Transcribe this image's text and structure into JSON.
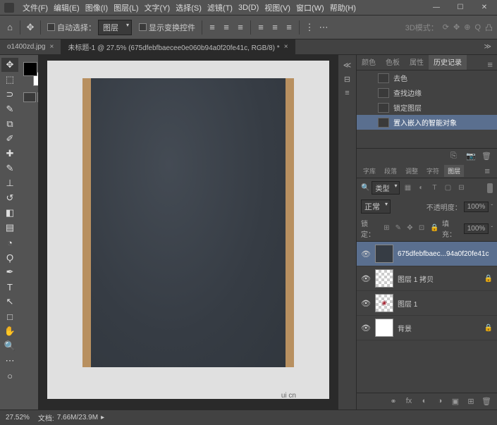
{
  "menu": {
    "items": [
      "文件(F)",
      "编辑(E)",
      "图像(I)",
      "图层(L)",
      "文字(Y)",
      "选择(S)",
      "滤镜(T)",
      "3D(D)",
      "视图(V)",
      "窗口(W)",
      "帮助(H)"
    ]
  },
  "options": {
    "auto_select_label": "自动选择：",
    "target": "图层",
    "transform_label": "显示变换控件",
    "mode3d_label": "3D模式："
  },
  "tabs": {
    "tab1": "o1400zd.jpg",
    "tab2": "未标题-1 @ 27.5% (675dfebfbaecee0e060b94a0f20fe41c, RGB/8) *"
  },
  "panels": {
    "tabs_top": [
      "颜色",
      "色板",
      "属性",
      "历史记录"
    ],
    "tabs_layers": [
      "字库",
      "段落",
      "调整",
      "字符",
      "图层"
    ]
  },
  "history": {
    "items": [
      {
        "label": "去色"
      },
      {
        "label": "查找边缘"
      },
      {
        "label": "锁定图层"
      },
      {
        "label": "置入嵌入的智能对象"
      }
    ]
  },
  "layers_filter": {
    "kind": "类型"
  },
  "blend": {
    "mode": "正常",
    "opacity_label": "不透明度：",
    "opacity": "100%",
    "lock_label": "锁定：",
    "fill_label": "填充：",
    "fill": "100%"
  },
  "layers": [
    {
      "name": "675dfebfbaec...94a0f20fe41c",
      "thumb": "dark",
      "locked": false
    },
    {
      "name": "图层 1 拷贝",
      "thumb": "checker",
      "locked": true
    },
    {
      "name": "图层 1",
      "thumb": "checker",
      "locked": false
    },
    {
      "name": "背景",
      "thumb": "white",
      "locked": true
    }
  ],
  "status": {
    "zoom": "27.52%",
    "doc_label": "文档:",
    "doc": "7.66M/23.9M"
  },
  "watermark": "ui cn"
}
